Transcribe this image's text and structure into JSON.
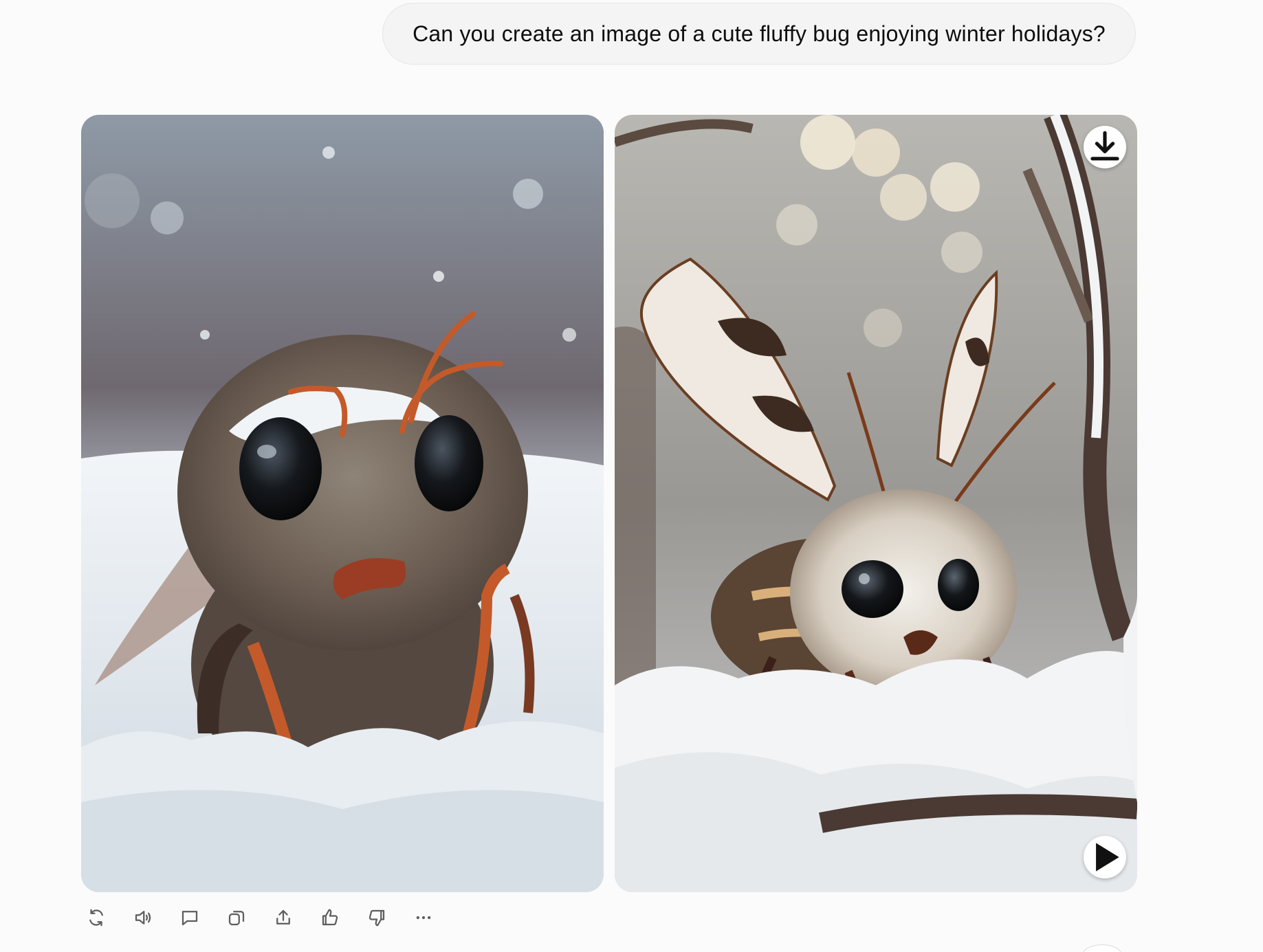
{
  "conversation": {
    "user_message": "Can you create an image of a cute fluffy bug enjoying winter holidays?"
  },
  "generated_images": [
    {
      "subject": "fluffy bug with big black eyes and orange antennae in snow"
    },
    {
      "subject": "fluffy bug with patterned wings on a snowy branch"
    }
  ],
  "image_controls": {
    "download_icon": "download-icon",
    "play_icon": "play-icon"
  },
  "actions": [
    {
      "name": "regenerate",
      "icon": "refresh-icon"
    },
    {
      "name": "read-aloud",
      "icon": "speaker-icon"
    },
    {
      "name": "comment",
      "icon": "chat-icon"
    },
    {
      "name": "copy",
      "icon": "copy-icon"
    },
    {
      "name": "share",
      "icon": "share-icon"
    },
    {
      "name": "good-response",
      "icon": "thumbs-up-icon"
    },
    {
      "name": "bad-response",
      "icon": "thumbs-down-icon"
    },
    {
      "name": "more",
      "icon": "more-icon"
    }
  ],
  "colors": {
    "background": "#fbfbfb",
    "bubble": "#f4f4f4",
    "icon": "#5d5d5d"
  }
}
